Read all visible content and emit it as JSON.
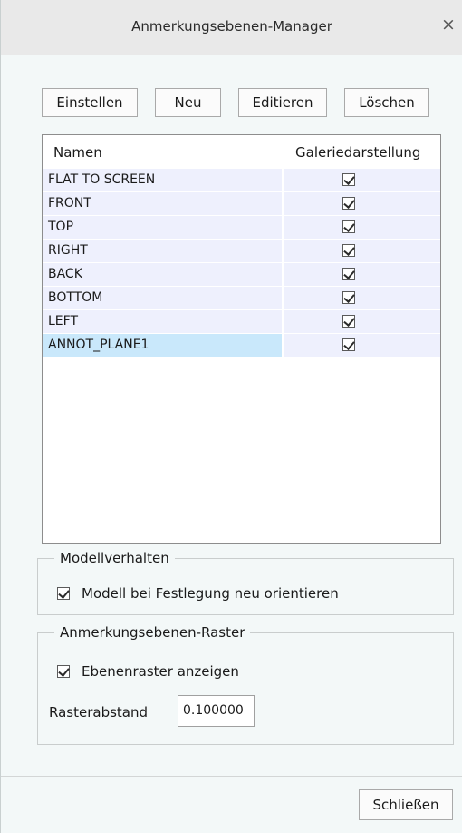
{
  "dialog": {
    "title": "Anmerkungsebenen-Manager",
    "close_symbol": "×"
  },
  "toolbar": {
    "einstellen": "Einstellen",
    "neu": "Neu",
    "editieren": "Editieren",
    "loeschen": "Löschen"
  },
  "table": {
    "col_name": "Namen",
    "col_gallery": "Galeriedarstellung",
    "rows": [
      {
        "name": "FLAT TO SCREEN",
        "gallery": true
      },
      {
        "name": "FRONT",
        "gallery": true
      },
      {
        "name": "TOP",
        "gallery": true
      },
      {
        "name": "RIGHT",
        "gallery": true
      },
      {
        "name": "BACK",
        "gallery": true
      },
      {
        "name": "BOTTOM",
        "gallery": true
      },
      {
        "name": "LEFT",
        "gallery": true
      },
      {
        "name": "ANNOT_PLANE1",
        "gallery": true,
        "selected": true
      }
    ]
  },
  "model_behavior": {
    "legend": "Modellverhalten",
    "reorient_label": "Modell bei Festlegung neu orientieren",
    "reorient_checked": true
  },
  "grid": {
    "legend": "Anmerkungsebenen-Raster",
    "show_label": "Ebenenraster anzeigen",
    "show_checked": true,
    "spacing_label": "Rasterabstand",
    "spacing_value": "0.100000"
  },
  "footer": {
    "close_label": "Schließen"
  },
  "colors": {
    "row_bg": "#eef0fd",
    "selected_bg": "#c9e8fb",
    "dialog_bg": "#f3f8f8",
    "titlebar_bg": "#e9e9e9"
  },
  "icons": {
    "close": "close-icon",
    "checkbox": "checkmark-icon"
  }
}
